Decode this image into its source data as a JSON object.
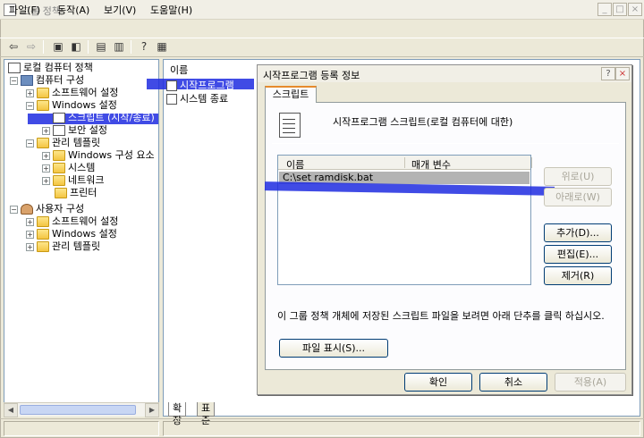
{
  "window": {
    "title": "그룹 정책",
    "controls": [
      "_",
      "□",
      "×"
    ]
  },
  "menu": [
    "파일(F)",
    "동작(A)",
    "보기(V)",
    "도움말(H)"
  ],
  "toolbar": [
    "back-icon",
    "forward-icon",
    "up-folder-icon",
    "show-tree-icon",
    "properties-icon",
    "export-icon",
    "help-icon",
    "view-icon"
  ],
  "tree": {
    "root": "로컬 컴퓨터 정책",
    "computer": "컴퓨터 구성",
    "software1": "소프트웨어 설정",
    "windows1": "Windows 설정",
    "scripts": "스크립트 (시작/종료)",
    "security": "보안 설정",
    "admin1": "관리 템플릿",
    "wincomp": "Windows 구성 요소",
    "system": "시스템",
    "network": "네트워크",
    "printer": "프린터",
    "user": "사용자 구성",
    "software2": "소프트웨어 설정",
    "windows2": "Windows 설정",
    "admin2": "관리 템플릿"
  },
  "right_pane": {
    "column": "이름",
    "items": [
      "시작프로그램",
      "시스템 종료"
    ],
    "tabs": [
      "확장",
      "표준"
    ]
  },
  "dialog": {
    "title": "시작프로그램 등록 정보",
    "tab": "스크립트",
    "heading": "시작프로그램 스크립트(로컬 컴퓨터에 대한)",
    "columns": [
      "이름",
      "매개 변수"
    ],
    "rows": [
      {
        "name": "C:\\set ramdisk.bat",
        "params": ""
      }
    ],
    "buttons": {
      "up": "위로(U)",
      "down": "아래로(W)",
      "add": "추가(D)...",
      "edit": "편집(E)...",
      "remove": "제거(R)",
      "show_files": "파일 표시(S)...",
      "ok": "확인",
      "cancel": "취소",
      "apply": "적용(A)"
    },
    "info": "이 그룹 정책 개체에 저장된 스크립트 파일을 보려면 아래 단추를 클릭 하십시오."
  },
  "colors": {
    "highlight": "#1e2be0",
    "selected_row": "#b3b3b3",
    "tab_accent": "#e68b2c"
  }
}
